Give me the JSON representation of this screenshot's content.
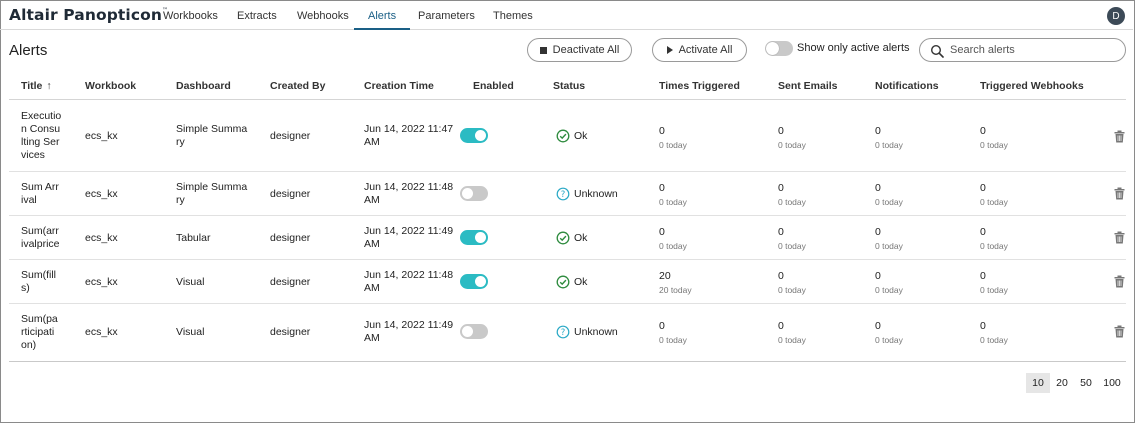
{
  "app": {
    "brand": "Altair Panopticon",
    "trademark": "™",
    "user_initial": "D"
  },
  "nav": {
    "tabs": [
      {
        "label": "Workbooks",
        "active": false
      },
      {
        "label": "Extracts",
        "active": false
      },
      {
        "label": "Webhooks",
        "active": false
      },
      {
        "label": "Alerts",
        "active": true
      },
      {
        "label": "Parameters",
        "active": false
      },
      {
        "label": "Themes",
        "active": false
      }
    ]
  },
  "header": {
    "title": "Alerts",
    "deactivate_all": "Deactivate All",
    "activate_all": "Activate All",
    "active_only_label": "Show only active alerts",
    "active_only_checked": false,
    "search_placeholder": "Search alerts",
    "search_value": ""
  },
  "table": {
    "columns": {
      "title": "Title",
      "title_sort": "↑",
      "workbook": "Workbook",
      "dashboard": "Dashboard",
      "created_by": "Created By",
      "creation_time": "Creation Time",
      "enabled": "Enabled",
      "status": "Status",
      "times_triggered": "Times Triggered",
      "sent_emails": "Sent Emails",
      "notifications": "Notifications",
      "triggered_webhooks": "Triggered Webhooks"
    },
    "rows": [
      {
        "title_lines": [
          "Executio",
          "n Consu",
          "lting Ser",
          "vices"
        ],
        "workbook": "ecs_kx",
        "dashboard_lines": [
          "Simple Summa",
          "ry"
        ],
        "created_by": "designer",
        "time_lines": [
          "Jun 14, 2022 11:47",
          "AM"
        ],
        "enabled": true,
        "status": "Ok",
        "times_triggered": "0",
        "times_triggered_today": "0 today",
        "sent_emails": "0",
        "sent_emails_today": "0 today",
        "notifications": "0",
        "notifications_today": "0 today",
        "webhooks": "0",
        "webhooks_today": "0 today"
      },
      {
        "title_lines": [
          "Sum Arr",
          "ival"
        ],
        "workbook": "ecs_kx",
        "dashboard_lines": [
          "Simple Summa",
          "ry"
        ],
        "created_by": "designer",
        "time_lines": [
          "Jun 14, 2022 11:48",
          "AM"
        ],
        "enabled": false,
        "status": "Unknown",
        "times_triggered": "0",
        "times_triggered_today": "0 today",
        "sent_emails": "0",
        "sent_emails_today": "0 today",
        "notifications": "0",
        "notifications_today": "0 today",
        "webhooks": "0",
        "webhooks_today": "0 today"
      },
      {
        "title_lines": [
          "Sum(arr",
          "ivalprice"
        ],
        "workbook": "ecs_kx",
        "dashboard_lines": [
          "Tabular"
        ],
        "created_by": "designer",
        "time_lines": [
          "Jun 14, 2022 11:49",
          "AM"
        ],
        "enabled": true,
        "status": "Ok",
        "times_triggered": "0",
        "times_triggered_today": "0 today",
        "sent_emails": "0",
        "sent_emails_today": "0 today",
        "notifications": "0",
        "notifications_today": "0 today",
        "webhooks": "0",
        "webhooks_today": "0 today"
      },
      {
        "title_lines": [
          "Sum(fill",
          "s)"
        ],
        "workbook": "ecs_kx",
        "dashboard_lines": [
          "Visual"
        ],
        "created_by": "designer",
        "time_lines": [
          "Jun 14, 2022 11:48",
          "AM"
        ],
        "enabled": true,
        "status": "Ok",
        "times_triggered": "20",
        "times_triggered_today": "20 today",
        "sent_emails": "0",
        "sent_emails_today": "0 today",
        "notifications": "0",
        "notifications_today": "0 today",
        "webhooks": "0",
        "webhooks_today": "0 today"
      },
      {
        "title_lines": [
          "Sum(pa",
          "rticipati",
          "on)"
        ],
        "workbook": "ecs_kx",
        "dashboard_lines": [
          "Visual"
        ],
        "created_by": "designer",
        "time_lines": [
          "Jun 14, 2022 11:49",
          "AM"
        ],
        "enabled": false,
        "status": "Unknown",
        "times_triggered": "0",
        "times_triggered_today": "0 today",
        "sent_emails": "0",
        "sent_emails_today": "0 today",
        "notifications": "0",
        "notifications_today": "0 today",
        "webhooks": "0",
        "webhooks_today": "0 today"
      }
    ]
  },
  "pagination": {
    "sizes": [
      "10",
      "20",
      "50",
      "100"
    ],
    "selected": "10"
  },
  "colors": {
    "accent": "#1a5f86",
    "toggle_on": "#2bbbc3",
    "ok": "#2e8b3e",
    "unknown": "#2aa9c6"
  }
}
